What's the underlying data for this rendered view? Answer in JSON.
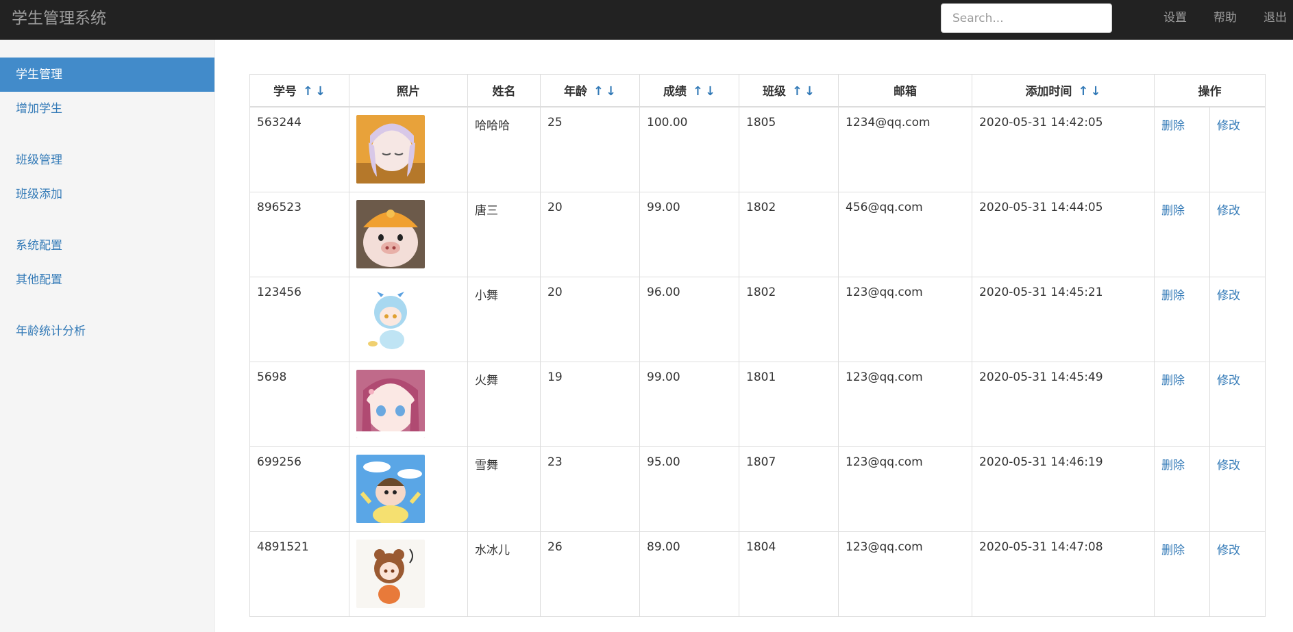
{
  "navbar": {
    "brand": "学生管理系统",
    "search_placeholder": "Search...",
    "links": [
      "设置",
      "帮助",
      "退出"
    ]
  },
  "sidebar": {
    "items": [
      {
        "label": "学生管理",
        "active": true
      },
      {
        "label": "增加学生",
        "active": false
      },
      {
        "label": "班级管理",
        "active": false
      },
      {
        "label": "班级添加",
        "active": false
      },
      {
        "label": "系统配置",
        "active": false
      },
      {
        "label": "其他配置",
        "active": false
      },
      {
        "label": "年龄统计分析",
        "active": false
      }
    ]
  },
  "table": {
    "headers": [
      "学号",
      "照片",
      "姓名",
      "年龄",
      "成绩",
      "班级",
      "邮箱",
      "添加时间",
      "操作"
    ],
    "sort_up": "↑",
    "sort_down": "↓",
    "delete_label": "删除",
    "edit_label": "修改",
    "rows": [
      {
        "id": "563244",
        "photo": "avatar-lilac-hair-girl",
        "name": "哈哈哈",
        "age": "25",
        "score": "100.00",
        "class": "1805",
        "email": "1234@qq.com",
        "added": "2020-05-31 14:42:05"
      },
      {
        "id": "896523",
        "photo": "avatar-pig-orange-cap",
        "name": "唐三",
        "age": "20",
        "score": "99.00",
        "class": "1802",
        "email": "456@qq.com",
        "added": "2020-05-31 14:44:05"
      },
      {
        "id": "123456",
        "photo": "avatar-blue-chibi",
        "name": "小舞",
        "age": "20",
        "score": "96.00",
        "class": "1802",
        "email": "123@qq.com",
        "added": "2020-05-31 14:45:21"
      },
      {
        "id": "5698",
        "photo": "avatar-pink-hair-girl",
        "name": "火舞",
        "age": "19",
        "score": "99.00",
        "class": "1801",
        "email": "123@qq.com",
        "added": "2020-05-31 14:45:49"
      },
      {
        "id": "699256",
        "photo": "avatar-cartoon-boy-sky",
        "name": "雪舞",
        "age": "23",
        "score": "95.00",
        "class": "1807",
        "email": "123@qq.com",
        "added": "2020-05-31 14:46:19"
      },
      {
        "id": "4891521",
        "photo": "avatar-bear-hood-girl",
        "name": "水冰儿",
        "age": "26",
        "score": "89.00",
        "class": "1804",
        "email": "123@qq.com",
        "added": "2020-05-31 14:47:08"
      }
    ]
  },
  "colors": {
    "navbar_bg": "#222222",
    "sidebar_bg": "#f5f5f5",
    "active_bg": "#428bca",
    "link": "#337ab7"
  }
}
